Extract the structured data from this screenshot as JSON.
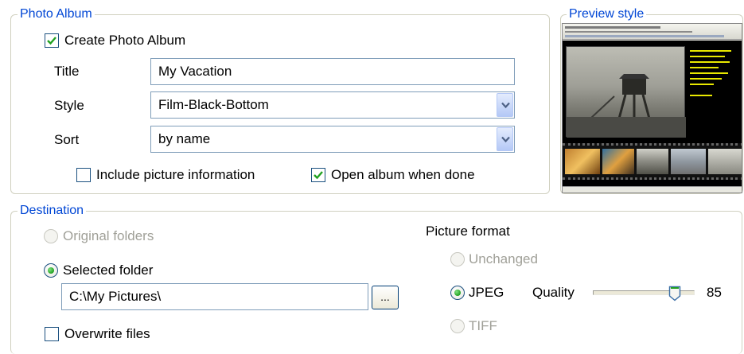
{
  "photo_album": {
    "legend": "Photo Album",
    "create_checkbox": {
      "label": "Create Photo Album",
      "checked": true
    },
    "title": {
      "label": "Title",
      "value": "My Vacation"
    },
    "style": {
      "label": "Style",
      "value": "Film-Black-Bottom"
    },
    "sort": {
      "label": "Sort",
      "value": "by name"
    },
    "include_info": {
      "label": "Include picture information",
      "checked": false
    },
    "open_when_done": {
      "label": "Open album when done",
      "checked": true
    }
  },
  "preview": {
    "legend": "Preview style",
    "colors": {
      "photo_bg": "#000000",
      "caption_text": "#e8e800"
    }
  },
  "destination": {
    "legend": "Destination",
    "original_folders": {
      "label": "Original folders",
      "selected": false,
      "enabled": false
    },
    "selected_folder": {
      "label": "Selected folder",
      "selected": true,
      "enabled": true
    },
    "folder_path": "C:\\My Pictures\\",
    "browse_label": "...",
    "overwrite": {
      "label": "Overwrite files",
      "checked": false
    }
  },
  "picture_format": {
    "label": "Picture format",
    "options": [
      {
        "label": "Unchanged",
        "selected": false,
        "enabled": false
      },
      {
        "label": "JPEG",
        "selected": true,
        "enabled": true
      },
      {
        "label": "TIFF",
        "selected": false,
        "enabled": false
      }
    ],
    "quality": {
      "label": "Quality",
      "value": "85",
      "min": 0,
      "max": 100
    }
  },
  "colors": {
    "legend_text": "#0046d5",
    "disabled_text": "#a0a098",
    "check_mark": "#21a121",
    "input_border": "#7f9db9"
  }
}
